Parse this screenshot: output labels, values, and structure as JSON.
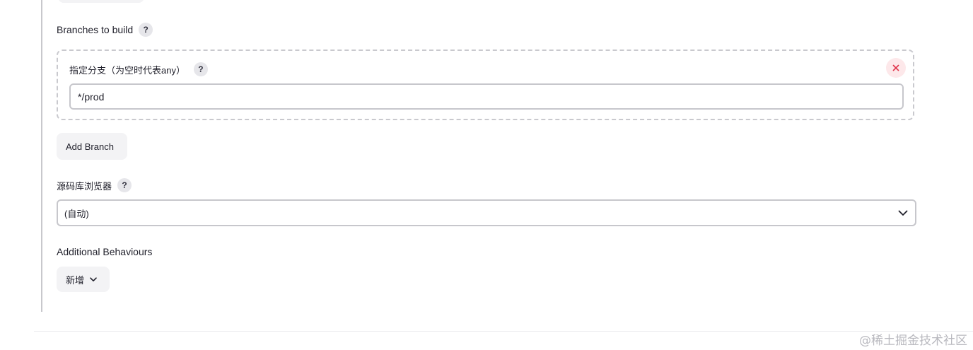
{
  "branches": {
    "section_label": "Branches to build",
    "help": "?",
    "entry": {
      "label": "指定分支（为空时代表any）",
      "help": "?",
      "value": "*/prod",
      "remove_icon": "close-icon"
    },
    "add_button_label": "Add Branch"
  },
  "browser": {
    "label": "源码库浏览器",
    "help": "?",
    "selected": "(自动)",
    "dropdown_icon": "chevron-down-icon"
  },
  "behaviours": {
    "label": "Additional Behaviours",
    "add_button_label": "新增",
    "dropdown_icon": "chevron-down-icon"
  },
  "watermark": "@稀土掘金技术社区",
  "colors": {
    "remove_icon": "#e0334a",
    "remove_bg": "#fde8ea",
    "button_bg": "#f3f3f5",
    "border": "#c7c7cc"
  }
}
